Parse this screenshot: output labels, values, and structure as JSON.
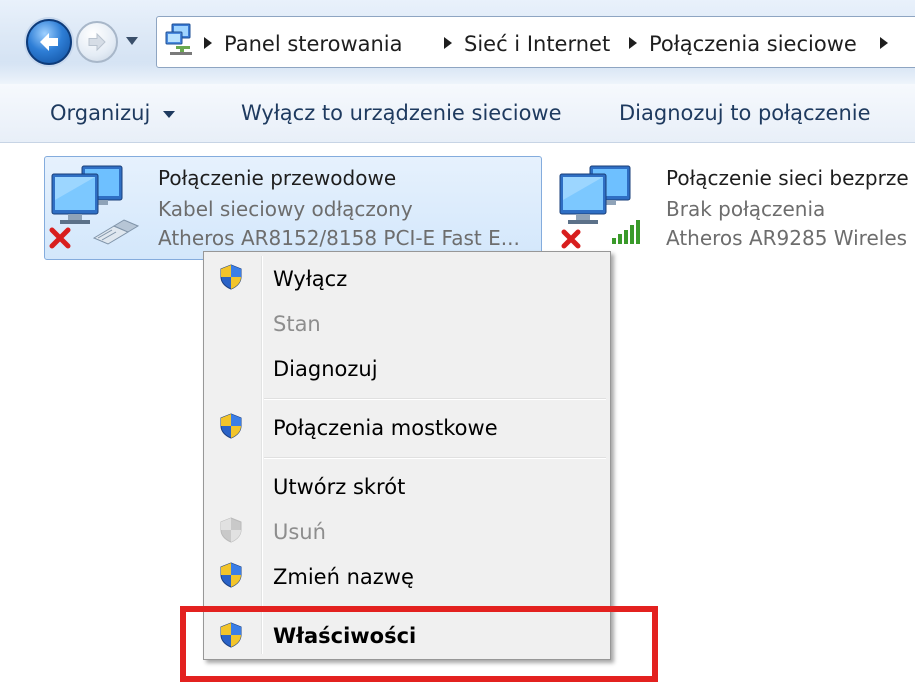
{
  "address_bar": {
    "breadcrumbs": [
      "Panel sterowania",
      "Sieć i Internet",
      "Połączenia sieciowe"
    ],
    "back_icon": "back-arrow-icon",
    "forward_icon": "forward-arrow-icon"
  },
  "toolbar": {
    "organize": "Organizuj",
    "disable": "Wyłącz to urządzenie sieciowe",
    "diagnose": "Diagnozuj to połączenie"
  },
  "connections": [
    {
      "title": "Połączenie przewodowe",
      "status": "Kabel sieciowy odłączony",
      "adapter": "Atheros AR8152/8158 PCI-E Fast E...",
      "selected": true,
      "icon": "wired-network-disconnected-icon"
    },
    {
      "title": "Połączenie sieci bezprze",
      "status": "Brak połączenia",
      "adapter": "Atheros AR9285 Wireles",
      "selected": false,
      "icon": "wireless-network-disconnected-icon"
    }
  ],
  "context_menu": {
    "items": [
      {
        "label": "Wyłącz",
        "shield": true,
        "enabled": true,
        "bold": false
      },
      {
        "label": "Stan",
        "shield": false,
        "enabled": false,
        "bold": false
      },
      {
        "label": "Diagnozuj",
        "shield": false,
        "enabled": true,
        "bold": false
      },
      {
        "label": "Połączenia mostkowe",
        "shield": true,
        "enabled": true,
        "bold": false
      },
      {
        "label": "Utwórz skrót",
        "shield": false,
        "enabled": true,
        "bold": false
      },
      {
        "label": "Usuń",
        "shield": true,
        "enabled": false,
        "bold": false
      },
      {
        "label": "Zmień nazwę",
        "shield": true,
        "enabled": true,
        "bold": false
      },
      {
        "label": "Właściwości",
        "shield": true,
        "enabled": true,
        "bold": true
      }
    ]
  },
  "colors": {
    "highlight": "#e3211f",
    "selection": "#d3e7fb",
    "disabled_text": "#8d8d8d"
  }
}
